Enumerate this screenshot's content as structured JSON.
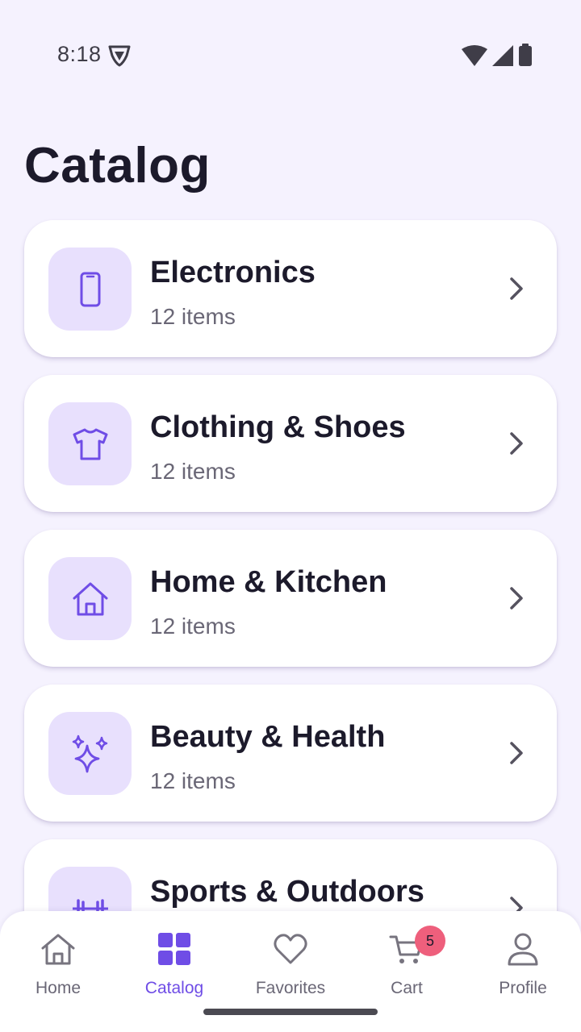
{
  "status_bar": {
    "time": "8:18"
  },
  "page": {
    "title": "Catalog"
  },
  "categories": [
    {
      "name": "Electronics",
      "count": "12 items",
      "icon": "smartphone-icon"
    },
    {
      "name": "Clothing & Shoes",
      "count": "12 items",
      "icon": "tshirt-icon"
    },
    {
      "name": "Home & Kitchen",
      "count": "12 items",
      "icon": "house-icon"
    },
    {
      "name": "Beauty & Health",
      "count": "12 items",
      "icon": "sparkles-icon"
    },
    {
      "name": "Sports & Outdoors",
      "count": "",
      "icon": "dumbbell-icon"
    }
  ],
  "bottom_nav": {
    "items": [
      {
        "label": "Home",
        "icon": "home-icon",
        "active": false
      },
      {
        "label": "Catalog",
        "icon": "grid-icon",
        "active": true
      },
      {
        "label": "Favorites",
        "icon": "heart-icon",
        "active": false
      },
      {
        "label": "Cart",
        "icon": "cart-icon",
        "active": false,
        "badge": "5"
      },
      {
        "label": "Profile",
        "icon": "person-icon",
        "active": false
      }
    ]
  },
  "colors": {
    "background": "#f5f2fe",
    "accent": "#6f4de6",
    "icon_tile": "#e8e0fd",
    "badge": "#ee5f7c",
    "text_primary": "#1c1a2b",
    "text_secondary": "#6a6776"
  }
}
